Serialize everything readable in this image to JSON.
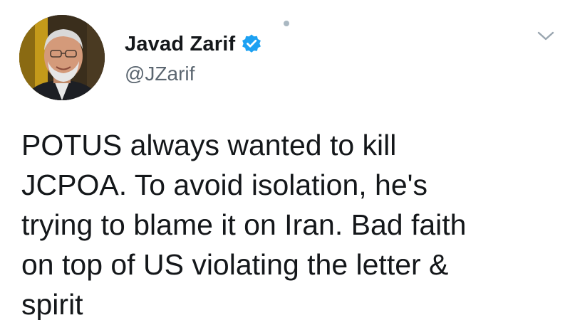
{
  "author": {
    "display_name": "Javad Zarif",
    "handle": "@JZarif",
    "verified": true
  },
  "tweet": {
    "text": "POTUS always wanted to kill\nJCPOA. To avoid isolation, he's\ntrying to blame it on Iran. Bad faith\non top of US violating the letter &\nspirit"
  },
  "icons": {
    "verified": "verified-badge-icon",
    "menu": "chevron-down-icon"
  },
  "colors": {
    "verified_blue": "#1da1f2",
    "text": "#14171a",
    "secondary_text": "#5b6670"
  }
}
